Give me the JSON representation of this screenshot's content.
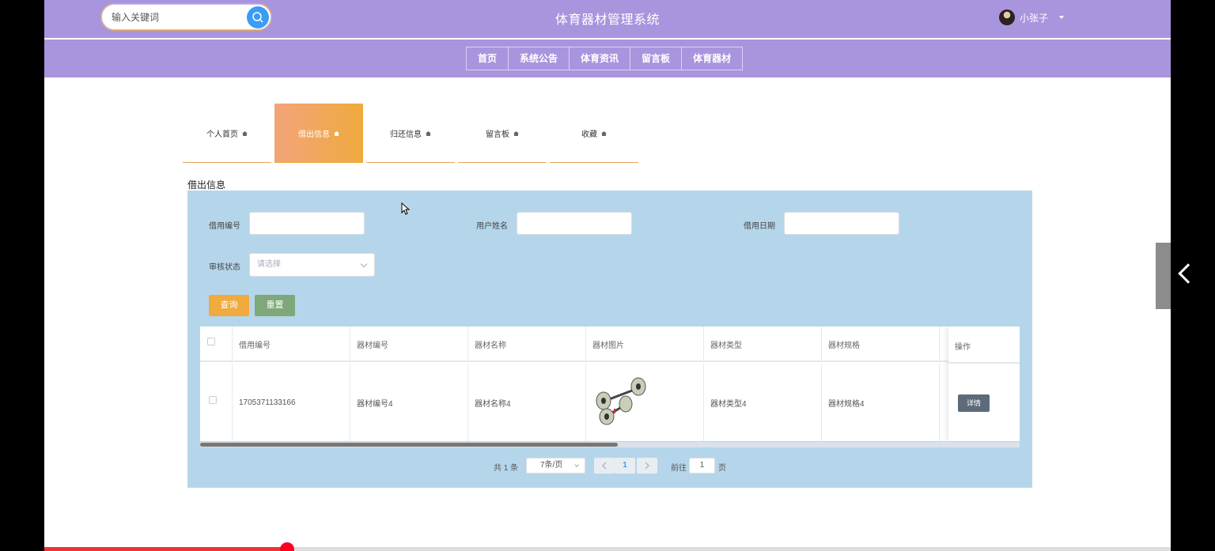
{
  "header": {
    "search_placeholder": "输入关键词",
    "site_title": "体育器材管理系统",
    "username": "小张子"
  },
  "nav": {
    "items": [
      "首页",
      "系统公告",
      "体育资讯",
      "留言板",
      "体育器材"
    ]
  },
  "tabs": {
    "items": [
      "个人首页",
      "借出信息",
      "归还信息",
      "留言板",
      "收藏"
    ],
    "active": "借出信息"
  },
  "section": {
    "title": "借出信息"
  },
  "filters": {
    "borrow_no_label": "借用编号",
    "user_name_label": "用户姓名",
    "borrow_date_label": "借用日期",
    "audit_status_label": "审核状态",
    "audit_status_placeholder": "请选择",
    "query_button": "查询",
    "reset_button": "重置"
  },
  "table": {
    "columns": [
      "借用编号",
      "器材编号",
      "器材名称",
      "器材图片",
      "器材类型",
      "器材规格",
      "操作"
    ],
    "rows": [
      {
        "borrow_no": "1705371133166",
        "equipment_no": "器材编号4",
        "equipment_name": "器材名称4",
        "equipment_type": "器材类型4",
        "equipment_spec": "器材规格4",
        "action": "详情"
      }
    ]
  },
  "pagination": {
    "total": "共 1 条",
    "page_size": "7条/页",
    "current_page": "1",
    "goto_label": "前往",
    "goto_value": "1",
    "page_suffix": "页"
  },
  "colors": {
    "header_bg": "#a994de",
    "panel_bg": "#b5d6ea",
    "query_btn": "#f0aa3e",
    "reset_btn": "#7fa87a",
    "detail_btn": "#5b6b7a"
  }
}
